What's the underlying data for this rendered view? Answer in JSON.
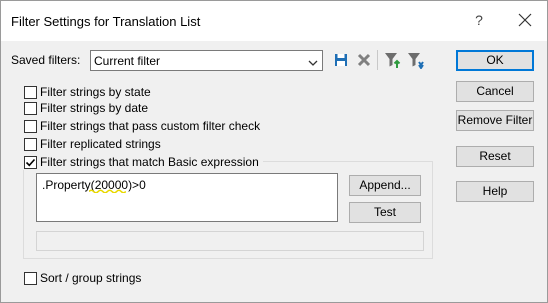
{
  "window": {
    "title": "Filter Settings for Translation List",
    "help_glyph": "?"
  },
  "saved_filters": {
    "label": "Saved filters:",
    "value": "Current filter"
  },
  "toolbar_icons": [
    "save-icon",
    "delete-icon",
    "apply-filter-icon",
    "filter-options-icon"
  ],
  "options": [
    {
      "label": "Filter strings by state",
      "checked": false
    },
    {
      "label": "Filter strings by date",
      "checked": false
    },
    {
      "label": "Filter strings that pass custom filter check",
      "checked": false
    },
    {
      "label": "Filter replicated strings",
      "checked": false
    }
  ],
  "basic_expression": {
    "label": "Filter strings that match Basic expression",
    "checked": true,
    "expr_prefix": ".Property(",
    "expr_highlight": "20000",
    "expr_suffix": ")>0",
    "append_label": "Append...",
    "test_label": "Test",
    "status_text": ""
  },
  "sort_group": {
    "label": "Sort / group strings",
    "checked": false
  },
  "buttons": {
    "ok": "OK",
    "cancel": "Cancel",
    "remove_filter": "Remove Filter",
    "reset": "Reset",
    "help": "Help"
  },
  "colors": {
    "accent": "#0078d7",
    "squiggle": "#e8d800",
    "save_icon": "#1f6fb5"
  }
}
